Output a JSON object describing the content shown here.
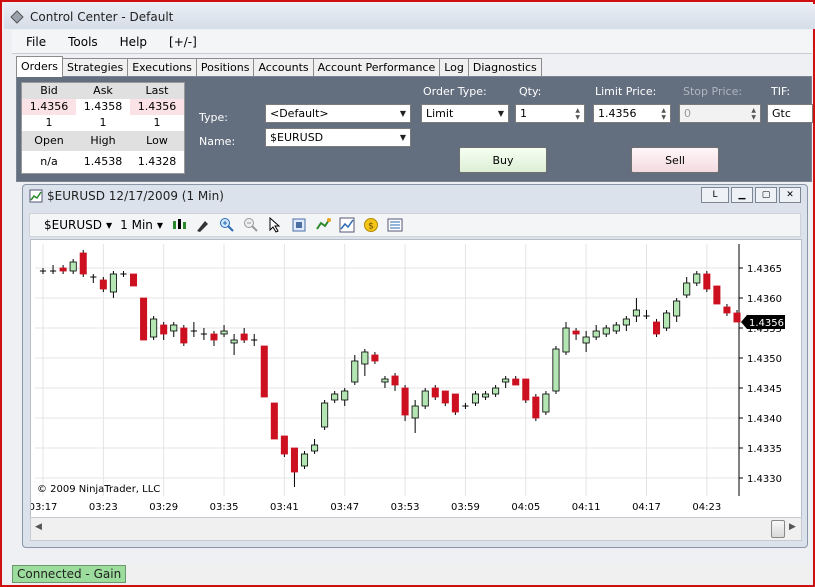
{
  "window": {
    "title": "Control Center - Default"
  },
  "menu": [
    "File",
    "Tools",
    "Help",
    "[+/-]"
  ],
  "tabs": [
    "Orders",
    "Strategies",
    "Executions",
    "Positions",
    "Accounts",
    "Account Performance",
    "Log",
    "Diagnostics"
  ],
  "quote": {
    "bid_label": "Bid",
    "ask_label": "Ask",
    "last_label": "Last",
    "bid": "1.4356",
    "ask": "1.4358",
    "last": "1.4356",
    "bid_size": "1",
    "ask_size": "1",
    "last_size": "1",
    "open_label": "Open",
    "high_label": "High",
    "low_label": "Low",
    "open": "n/a",
    "high": "1.4538",
    "low": "1.4328"
  },
  "order": {
    "type_label": "Type:",
    "type_value": "<Default>",
    "name_label": "Name:",
    "name_value": "$EURUSD",
    "order_type_label": "Order Type:",
    "order_type_value": "Limit",
    "qty_label": "Qty:",
    "qty_value": "1",
    "limit_price_label": "Limit Price:",
    "limit_price_value": "1.4356",
    "stop_price_label": "Stop Price:",
    "stop_price_value": "0",
    "tif_label": "TIF:",
    "tif_value": "Gtc",
    "buy_label": "Buy",
    "sell_label": "Sell"
  },
  "chart_window": {
    "title": "$EURUSD  12/17/2009 (1 Min)",
    "btn_l": "L",
    "instrument": "$EURUSD",
    "interval": "1 Min",
    "copyright": "© 2009 NinjaTrader, LLC",
    "last_price_tag": "1.4356"
  },
  "status": {
    "connection": "Connected - Gain"
  },
  "colors": {
    "up": "#b3e6b3",
    "down": "#cc1020",
    "outline": "#000000"
  },
  "chart_data": {
    "type": "candlestick",
    "x_tick_labels": [
      "03:17",
      "03:23",
      "03:29",
      "03:35",
      "03:41",
      "03:47",
      "03:53",
      "03:59",
      "04:05",
      "04:11",
      "04:17",
      "04:23"
    ],
    "y_tick_labels": [
      "1.4365",
      "1.4360",
      "1.4355",
      "1.4350",
      "1.4345",
      "1.4340",
      "1.4335",
      "1.4330"
    ],
    "ylim": [
      1.4327,
      1.4369
    ],
    "minutes_per_bar": 1,
    "start": "03:17",
    "bars": [
      {
        "o": 1.43645,
        "h": 1.4365,
        "l": 1.4364,
        "c": 1.43645
      },
      {
        "o": 1.43645,
        "h": 1.43655,
        "l": 1.4364,
        "c": 1.43645
      },
      {
        "o": 1.4365,
        "h": 1.43655,
        "l": 1.4364,
        "c": 1.43645
      },
      {
        "o": 1.43645,
        "h": 1.43665,
        "l": 1.4364,
        "c": 1.4366
      },
      {
        "o": 1.43675,
        "h": 1.4368,
        "l": 1.43635,
        "c": 1.4364
      },
      {
        "o": 1.43635,
        "h": 1.4364,
        "l": 1.43625,
        "c": 1.43635
      },
      {
        "o": 1.4363,
        "h": 1.43635,
        "l": 1.4361,
        "c": 1.43615
      },
      {
        "o": 1.4361,
        "h": 1.43645,
        "l": 1.436,
        "c": 1.4364
      },
      {
        "o": 1.4364,
        "h": 1.43645,
        "l": 1.43635,
        "c": 1.4364
      },
      {
        "o": 1.4364,
        "h": 1.4364,
        "l": 1.4362,
        "c": 1.4362
      },
      {
        "o": 1.436,
        "h": 1.436,
        "l": 1.4353,
        "c": 1.4353
      },
      {
        "o": 1.43535,
        "h": 1.4357,
        "l": 1.4353,
        "c": 1.43565
      },
      {
        "o": 1.43555,
        "h": 1.4356,
        "l": 1.4353,
        "c": 1.4354
      },
      {
        "o": 1.43545,
        "h": 1.4356,
        "l": 1.43535,
        "c": 1.43555
      },
      {
        "o": 1.4355,
        "h": 1.43555,
        "l": 1.4352,
        "c": 1.43525
      },
      {
        "o": 1.43545,
        "h": 1.4356,
        "l": 1.43535,
        "c": 1.43545
      },
      {
        "o": 1.4354,
        "h": 1.4355,
        "l": 1.4353,
        "c": 1.4354
      },
      {
        "o": 1.4354,
        "h": 1.43545,
        "l": 1.4352,
        "c": 1.4353
      },
      {
        "o": 1.4354,
        "h": 1.43555,
        "l": 1.43535,
        "c": 1.43545
      },
      {
        "o": 1.43525,
        "h": 1.4354,
        "l": 1.43505,
        "c": 1.4353
      },
      {
        "o": 1.4354,
        "h": 1.4355,
        "l": 1.43525,
        "c": 1.4353
      },
      {
        "o": 1.4353,
        "h": 1.4354,
        "l": 1.4352,
        "c": 1.4353
      },
      {
        "o": 1.4352,
        "h": 1.4352,
        "l": 1.43435,
        "c": 1.43435
      },
      {
        "o": 1.43425,
        "h": 1.43425,
        "l": 1.43365,
        "c": 1.43365
      },
      {
        "o": 1.4337,
        "h": 1.4337,
        "l": 1.43335,
        "c": 1.4334
      },
      {
        "o": 1.4335,
        "h": 1.4335,
        "l": 1.43285,
        "c": 1.4331
      },
      {
        "o": 1.4332,
        "h": 1.43345,
        "l": 1.43315,
        "c": 1.4334
      },
      {
        "o": 1.43345,
        "h": 1.43365,
        "l": 1.4334,
        "c": 1.43355
      },
      {
        "o": 1.43385,
        "h": 1.4343,
        "l": 1.4338,
        "c": 1.43425
      },
      {
        "o": 1.4343,
        "h": 1.43445,
        "l": 1.43425,
        "c": 1.4344
      },
      {
        "o": 1.4343,
        "h": 1.4345,
        "l": 1.4342,
        "c": 1.43445
      },
      {
        "o": 1.4346,
        "h": 1.43505,
        "l": 1.43455,
        "c": 1.43495
      },
      {
        "o": 1.4349,
        "h": 1.43515,
        "l": 1.4347,
        "c": 1.4351
      },
      {
        "o": 1.43505,
        "h": 1.4351,
        "l": 1.4349,
        "c": 1.43495
      },
      {
        "o": 1.4346,
        "h": 1.4347,
        "l": 1.4345,
        "c": 1.43465
      },
      {
        "o": 1.4347,
        "h": 1.43475,
        "l": 1.43445,
        "c": 1.43455
      },
      {
        "o": 1.4345,
        "h": 1.43455,
        "l": 1.43395,
        "c": 1.43405
      },
      {
        "o": 1.434,
        "h": 1.4343,
        "l": 1.43375,
        "c": 1.4342
      },
      {
        "o": 1.4342,
        "h": 1.4345,
        "l": 1.43415,
        "c": 1.43445
      },
      {
        "o": 1.4345,
        "h": 1.43455,
        "l": 1.4343,
        "c": 1.43435
      },
      {
        "o": 1.43445,
        "h": 1.43445,
        "l": 1.4342,
        "c": 1.43425
      },
      {
        "o": 1.4344,
        "h": 1.4344,
        "l": 1.43405,
        "c": 1.4341
      },
      {
        "o": 1.4342,
        "h": 1.43425,
        "l": 1.43415,
        "c": 1.4342
      },
      {
        "o": 1.43425,
        "h": 1.43445,
        "l": 1.4342,
        "c": 1.4344
      },
      {
        "o": 1.43435,
        "h": 1.43445,
        "l": 1.4343,
        "c": 1.4344
      },
      {
        "o": 1.4344,
        "h": 1.43455,
        "l": 1.43435,
        "c": 1.4345
      },
      {
        "o": 1.4346,
        "h": 1.4347,
        "l": 1.4345,
        "c": 1.43465
      },
      {
        "o": 1.43465,
        "h": 1.4347,
        "l": 1.43455,
        "c": 1.43455
      },
      {
        "o": 1.43465,
        "h": 1.43465,
        "l": 1.43425,
        "c": 1.4343
      },
      {
        "o": 1.43435,
        "h": 1.4344,
        "l": 1.43395,
        "c": 1.434
      },
      {
        "o": 1.4341,
        "h": 1.43445,
        "l": 1.43405,
        "c": 1.4344
      },
      {
        "o": 1.43445,
        "h": 1.4352,
        "l": 1.4344,
        "c": 1.43515
      },
      {
        "o": 1.4351,
        "h": 1.4356,
        "l": 1.43505,
        "c": 1.4355
      },
      {
        "o": 1.43545,
        "h": 1.4355,
        "l": 1.4353,
        "c": 1.4354
      },
      {
        "o": 1.43525,
        "h": 1.43545,
        "l": 1.4351,
        "c": 1.43535
      },
      {
        "o": 1.43535,
        "h": 1.43555,
        "l": 1.4353,
        "c": 1.43545
      },
      {
        "o": 1.4354,
        "h": 1.43555,
        "l": 1.43535,
        "c": 1.4355
      },
      {
        "o": 1.43545,
        "h": 1.4356,
        "l": 1.4354,
        "c": 1.43555
      },
      {
        "o": 1.43555,
        "h": 1.4357,
        "l": 1.43545,
        "c": 1.43565
      },
      {
        "o": 1.4357,
        "h": 1.436,
        "l": 1.4356,
        "c": 1.4358
      },
      {
        "o": 1.4357,
        "h": 1.4358,
        "l": 1.43565,
        "c": 1.4357
      },
      {
        "o": 1.4356,
        "h": 1.43565,
        "l": 1.43535,
        "c": 1.4354
      },
      {
        "o": 1.4355,
        "h": 1.4358,
        "l": 1.43545,
        "c": 1.43575
      },
      {
        "o": 1.4357,
        "h": 1.436,
        "l": 1.4356,
        "c": 1.43595
      },
      {
        "o": 1.43605,
        "h": 1.43635,
        "l": 1.436,
        "c": 1.43625
      },
      {
        "o": 1.43625,
        "h": 1.43645,
        "l": 1.4362,
        "c": 1.4364
      },
      {
        "o": 1.4364,
        "h": 1.43645,
        "l": 1.4361,
        "c": 1.43615
      },
      {
        "o": 1.4362,
        "h": 1.4362,
        "l": 1.4359,
        "c": 1.4359
      },
      {
        "o": 1.43585,
        "h": 1.4359,
        "l": 1.4357,
        "c": 1.43575
      },
      {
        "o": 1.43575,
        "h": 1.4358,
        "l": 1.4356,
        "c": 1.4356
      }
    ]
  }
}
